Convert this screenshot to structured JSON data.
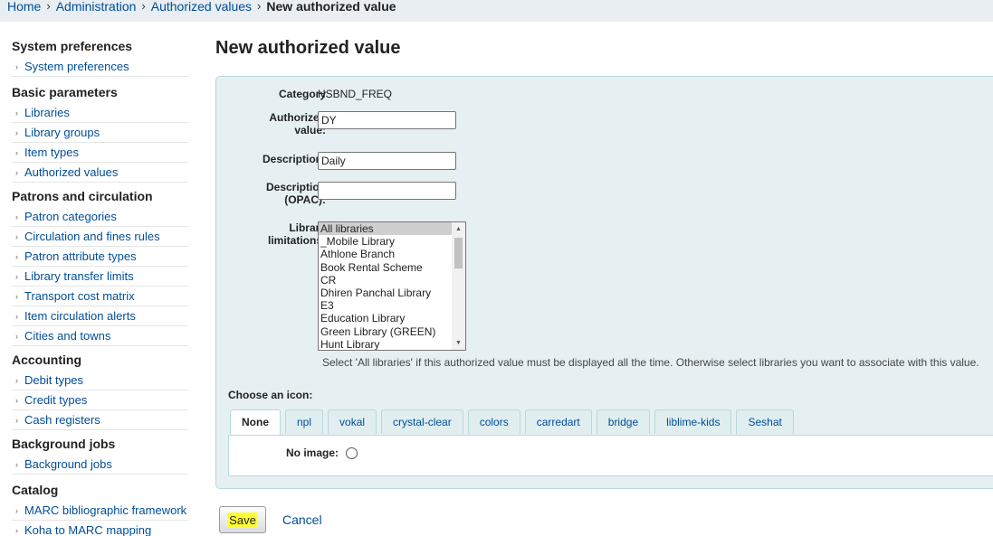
{
  "breadcrumb": {
    "items": [
      "Home",
      "Administration",
      "Authorized values"
    ],
    "current": "New authorized value",
    "separator": "›"
  },
  "sidebar": {
    "sections": [
      {
        "title": "System preferences",
        "items": [
          "System preferences"
        ]
      },
      {
        "title": "Basic parameters",
        "items": [
          "Libraries",
          "Library groups",
          "Item types",
          "Authorized values"
        ]
      },
      {
        "title": "Patrons and circulation",
        "items": [
          "Patron categories",
          "Circulation and fines rules",
          "Patron attribute types",
          "Library transfer limits",
          "Transport cost matrix",
          "Item circulation alerts",
          "Cities and towns"
        ]
      },
      {
        "title": "Accounting",
        "items": [
          "Debit types",
          "Credit types",
          "Cash registers"
        ]
      },
      {
        "title": "Background jobs",
        "items": [
          "Background jobs"
        ]
      },
      {
        "title": "Catalog",
        "items": [
          "MARC bibliographic framework",
          "Koha to MARC mapping"
        ]
      }
    ]
  },
  "page": {
    "title": "New authorized value"
  },
  "form": {
    "category": {
      "label": "Category",
      "value": "HSBND_FREQ"
    },
    "authorized_value": {
      "label_line1": "Authorized",
      "label_line2": "value:",
      "value": "DY"
    },
    "description": {
      "label": "Description:",
      "value": "Daily"
    },
    "description_opac": {
      "label_line1": "Description",
      "label_line2": "(OPAC):",
      "value": ""
    },
    "library_limitations": {
      "label_line1": "Library",
      "label_line2": "limitations:",
      "options": [
        "All libraries",
        "_Mobile Library",
        "Athlone Branch",
        "Book Rental Scheme",
        "CR",
        "Dhiren Panchal Library",
        "E3",
        "Education Library",
        "Green Library (GREEN)",
        "Hunt Library"
      ],
      "selected": "All libraries",
      "hint": "Select 'All libraries' if this authorized value must be displayed all the time. Otherwise select libraries you want to associate with this value."
    },
    "icon": {
      "label": "Choose an icon:",
      "tabs": [
        "None",
        "npl",
        "vokal",
        "crystal-clear",
        "colors",
        "carredart",
        "bridge",
        "liblime-kids",
        "Seshat"
      ],
      "active_tab": "None",
      "no_image_label": "No image:"
    }
  },
  "actions": {
    "save_label": "Save",
    "cancel_label": "Cancel"
  },
  "colors": {
    "link": "#004d99",
    "panel_bg": "#e6f0f2",
    "highlight": "#ffff33"
  }
}
